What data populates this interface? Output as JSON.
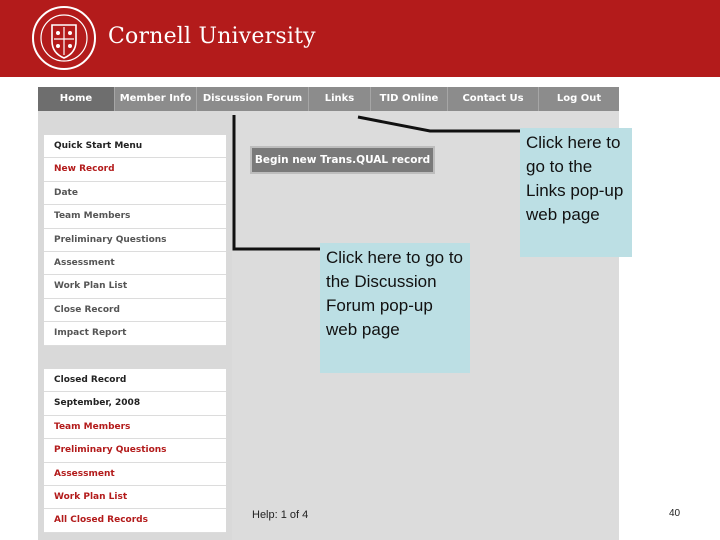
{
  "header": {
    "brand": "Cornell University",
    "colors": {
      "header_bg": "#b31b1b",
      "nav_bg": "#8c8c8c",
      "callout_bg": "#bcdfe4"
    }
  },
  "nav": {
    "items": [
      {
        "label": "Home",
        "active": true
      },
      {
        "label": "Member Info"
      },
      {
        "label": "Discussion Forum"
      },
      {
        "label": "Links"
      },
      {
        "label": "TID Online"
      },
      {
        "label": "Contact Us"
      },
      {
        "label": "Log Out"
      }
    ]
  },
  "sidebar": {
    "group1": [
      {
        "label": "Quick Start Menu",
        "style": "dark"
      },
      {
        "label": "New Record",
        "style": "red"
      },
      {
        "label": "Date"
      },
      {
        "label": "Team Members"
      },
      {
        "label": "Preliminary Questions"
      },
      {
        "label": "Assessment"
      },
      {
        "label": "Work Plan List"
      },
      {
        "label": "Close Record"
      },
      {
        "label": "Impact Report"
      }
    ],
    "group2": [
      {
        "label": "Closed Record",
        "style": "dark"
      },
      {
        "label": "September, 2008",
        "style": "dark"
      },
      {
        "label": "Team Members",
        "style": "red"
      },
      {
        "label": "Preliminary Questions",
        "style": "red"
      },
      {
        "label": "Assessment",
        "style": "red"
      },
      {
        "label": "Work Plan List",
        "style": "red"
      },
      {
        "label": "All Closed Records",
        "style": "red"
      }
    ]
  },
  "main": {
    "begin_button": "Begin new Trans.QUAL record",
    "help": "Help: 1 of 4"
  },
  "callouts": {
    "forum": "Click here to go to the Discussion Forum pop-up web page",
    "links": "Click here to go to the Links pop-up web page"
  },
  "slide": {
    "page_number": "40"
  }
}
